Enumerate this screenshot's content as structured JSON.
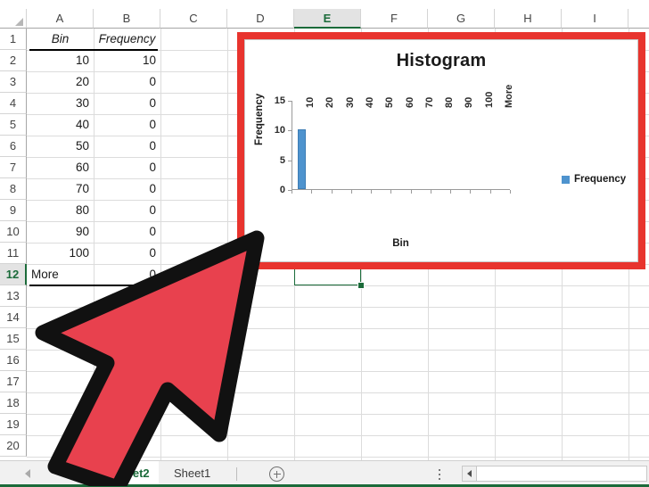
{
  "app": "Microsoft Excel spreadsheet with histogram chart",
  "spreadsheet": {
    "columns": [
      "A",
      "B",
      "C",
      "D",
      "E",
      "F",
      "G",
      "H",
      "I"
    ],
    "selected_column": "E",
    "rows": [
      "1",
      "2",
      "3",
      "4",
      "5",
      "6",
      "7",
      "8",
      "9",
      "10",
      "11",
      "12",
      "13",
      "14",
      "15",
      "16",
      "17",
      "18",
      "19",
      "20"
    ],
    "selected_row": "12",
    "selected_cell": "E12",
    "headers": {
      "a": "Bin",
      "b": "Frequency"
    },
    "data": [
      {
        "bin": "10",
        "frequency": "10"
      },
      {
        "bin": "20",
        "frequency": "0"
      },
      {
        "bin": "30",
        "frequency": "0"
      },
      {
        "bin": "40",
        "frequency": "0"
      },
      {
        "bin": "50",
        "frequency": "0"
      },
      {
        "bin": "60",
        "frequency": "0"
      },
      {
        "bin": "70",
        "frequency": "0"
      },
      {
        "bin": "80",
        "frequency": "0"
      },
      {
        "bin": "90",
        "frequency": "0"
      },
      {
        "bin": "100",
        "frequency": "0"
      },
      {
        "bin": "More",
        "frequency": "0"
      }
    ]
  },
  "chart_data": {
    "type": "bar",
    "title": "Histogram",
    "xlabel": "Bin",
    "ylabel": "Frequency",
    "categories": [
      "10",
      "20",
      "30",
      "40",
      "50",
      "60",
      "70",
      "80",
      "90",
      "100",
      "More"
    ],
    "values": [
      10,
      0,
      0,
      0,
      0,
      0,
      0,
      0,
      0,
      0,
      0
    ],
    "series": [
      {
        "name": "Frequency",
        "values": [
          10,
          0,
          0,
          0,
          0,
          0,
          0,
          0,
          0,
          0,
          0
        ]
      }
    ],
    "ylim": [
      0,
      15
    ],
    "yticks": [
      "0",
      "5",
      "10",
      "15"
    ],
    "grid": false,
    "legend_position": "right",
    "legend_entries": [
      "Frequency"
    ],
    "bar_color": "#4e93ce",
    "selection_border_color": "#e8342e"
  },
  "tabbar": {
    "tabs": [
      {
        "label": "Sheet2",
        "active": true
      },
      {
        "label": "Sheet1",
        "active": false
      }
    ],
    "add_sheet_label": "+"
  },
  "annotation": {
    "cursor": "large-red-arrow-pointer",
    "cursor_fill": "#e8414e",
    "cursor_outline": "#111111"
  }
}
